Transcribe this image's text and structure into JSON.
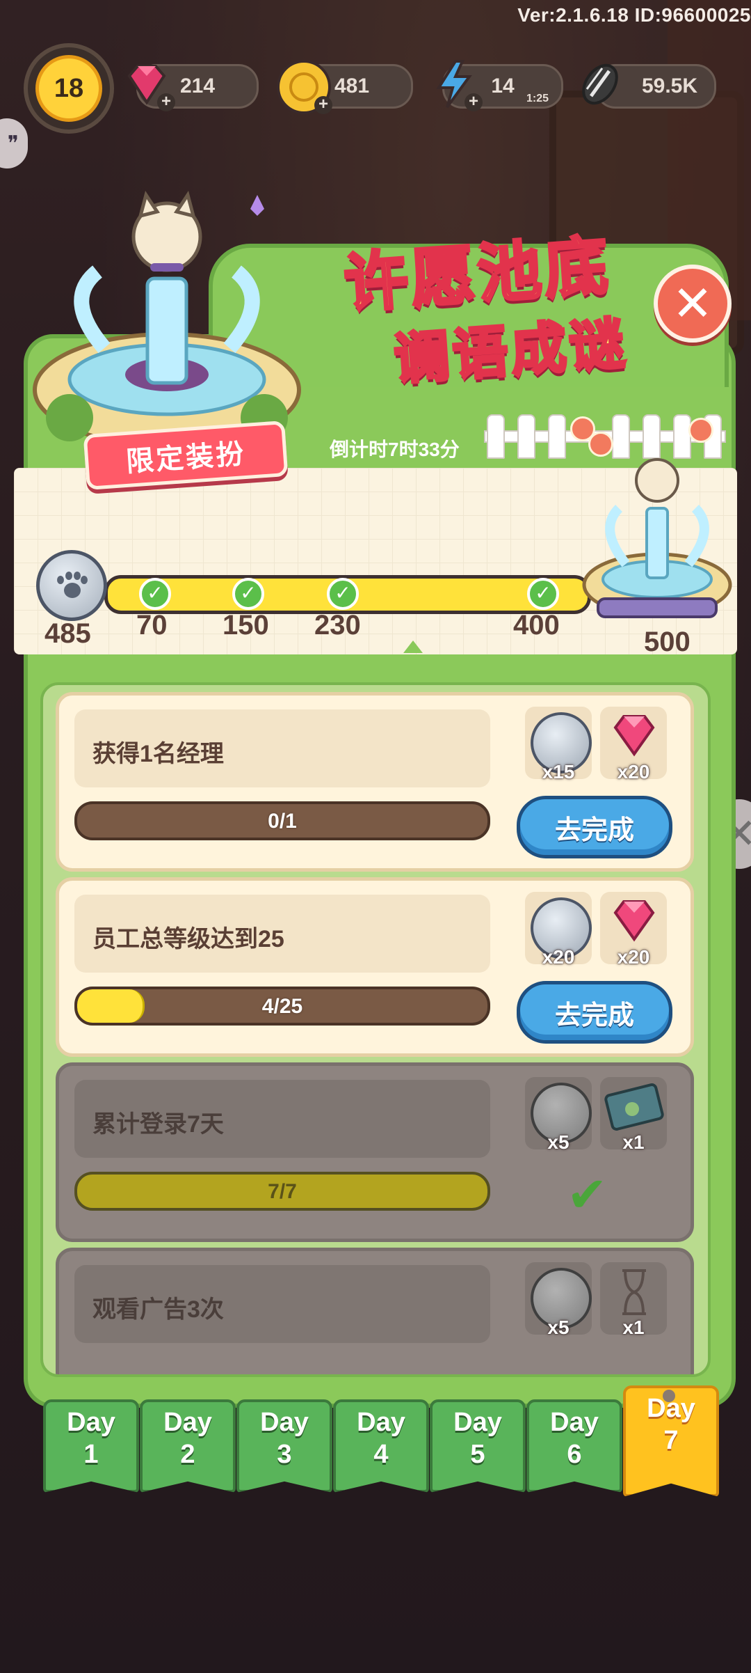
{
  "header": {
    "version": "Ver:2.1.6.18 ID:96600025",
    "level": "18",
    "gems": "214",
    "coins": "481",
    "energy": "14",
    "energy_timer": "1:25",
    "seeds": "59.5K"
  },
  "event": {
    "title_line1": "许愿池底",
    "title_line2": "谰语成谜",
    "limited_badge": "限定装扮",
    "countdown": "倒计时7时33分"
  },
  "progress": {
    "current": "485",
    "milestones": [
      "70",
      "150",
      "230",
      "400",
      "500"
    ]
  },
  "tasks": [
    {
      "desc": "获得1名经理",
      "progress": "0/1",
      "fill": 0,
      "rewards": [
        {
          "type": "paw-coin",
          "qty": "x15"
        },
        {
          "type": "gem",
          "qty": "x20"
        }
      ],
      "action": "去完成",
      "done": false
    },
    {
      "desc": "员工总等级达到25",
      "progress": "4/25",
      "fill": 0.16,
      "rewards": [
        {
          "type": "paw-coin",
          "qty": "x20"
        },
        {
          "type": "gem",
          "qty": "x20"
        }
      ],
      "action": "去完成",
      "done": false
    },
    {
      "desc": "累计登录7天",
      "progress": "7/7",
      "fill": 1,
      "rewards": [
        {
          "type": "paw-coin",
          "qty": "x5"
        },
        {
          "type": "seed-ticket",
          "qty": "x1"
        }
      ],
      "done": true
    },
    {
      "desc": "观看广告3次",
      "progress": "",
      "rewards": [
        {
          "type": "paw-coin",
          "qty": "x5"
        },
        {
          "type": "hourglass",
          "qty": "x1"
        }
      ],
      "done": true
    }
  ],
  "days": [
    {
      "line1": "Day",
      "line2": "1"
    },
    {
      "line1": "Day",
      "line2": "2"
    },
    {
      "line1": "Day",
      "line2": "3"
    },
    {
      "line1": "Day",
      "line2": "4"
    },
    {
      "line1": "Day",
      "line2": "5"
    },
    {
      "line1": "Day",
      "line2": "6"
    },
    {
      "line1": "Day",
      "line2": "7"
    }
  ],
  "active_day": 7,
  "colors": {
    "panel": "#8bc95a",
    "bar": "#ffe23a",
    "button": "#4aa9e6",
    "active_tab": "#ffc21f",
    "close": "#f06a55"
  }
}
